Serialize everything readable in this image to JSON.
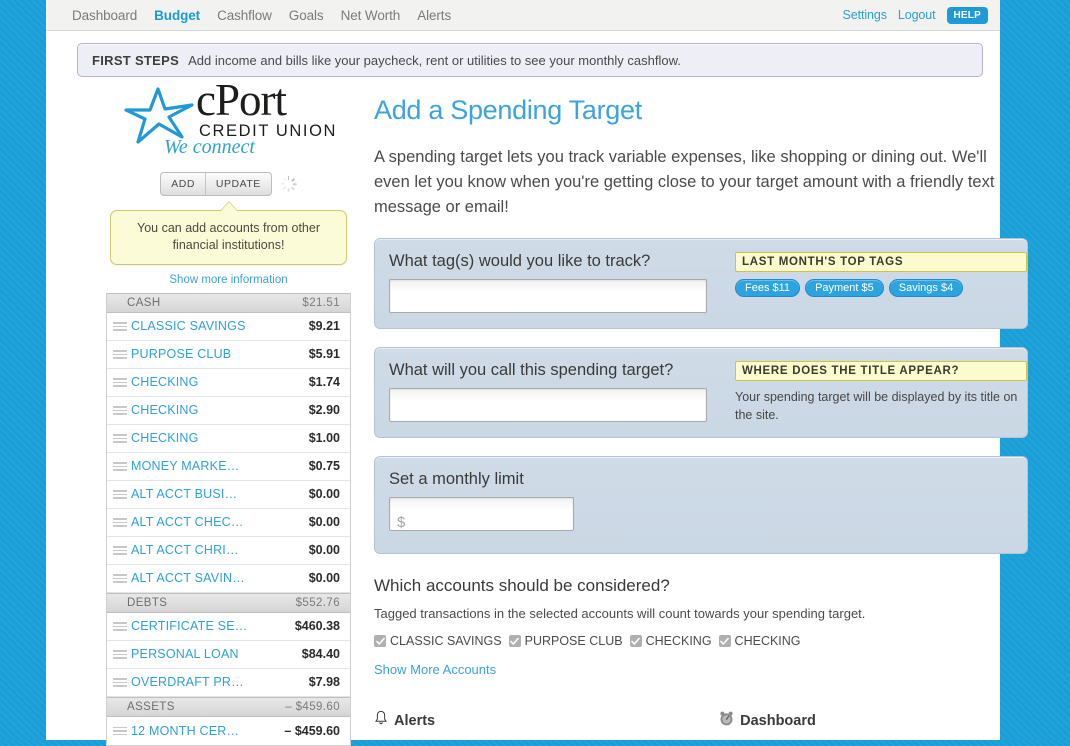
{
  "topnav": {
    "left_links": [
      {
        "label": "Dashboard",
        "active": false
      },
      {
        "label": "Budget",
        "active": true
      },
      {
        "label": "Cashflow",
        "active": false
      },
      {
        "label": "Goals",
        "active": false
      },
      {
        "label": "Net Worth",
        "active": false
      },
      {
        "label": "Alerts",
        "active": false
      }
    ],
    "settings_label": "Settings",
    "logout_label": "Logout",
    "help_label": "HELP"
  },
  "first_steps": {
    "label": "FIRST STEPS",
    "text": "Add income and bills like your paycheck, rent or utilities to see your monthly cashflow."
  },
  "logo": {
    "name": "cPort",
    "subtitle": "CREDIT UNION",
    "tagline": "We connect",
    "star_color": "#1f9ad6"
  },
  "sidebar": {
    "add_label": "ADD",
    "update_label": "UPDATE",
    "tooltip": "You can add accounts from other financial institutions!",
    "show_more_information": "Show more information",
    "groups": [
      {
        "name": "CASH",
        "total": "$21.51",
        "accounts": [
          {
            "name": "CLASSIC SAVINGS",
            "balance": "$9.21"
          },
          {
            "name": "PURPOSE CLUB",
            "balance": "$5.91"
          },
          {
            "name": "CHECKING",
            "balance": "$1.74"
          },
          {
            "name": "CHECKING",
            "balance": "$2.90"
          },
          {
            "name": "CHECKING",
            "balance": "$1.00"
          },
          {
            "name": "MONEY MARKE…",
            "balance": "$0.75"
          },
          {
            "name": "ALT ACCT BUSI…",
            "balance": "$0.00"
          },
          {
            "name": "ALT ACCT CHEC…",
            "balance": "$0.00"
          },
          {
            "name": "ALT ACCT CHRI…",
            "balance": "$0.00"
          },
          {
            "name": "ALT ACCT SAVIN…",
            "balance": "$0.00"
          }
        ]
      },
      {
        "name": "DEBTS",
        "total": "$552.76",
        "accounts": [
          {
            "name": "CERTIFICATE SE…",
            "balance": "$460.38"
          },
          {
            "name": "PERSONAL LOAN",
            "balance": "$84.40"
          },
          {
            "name": "OVERDRAFT PR…",
            "balance": "$7.98"
          }
        ]
      },
      {
        "name": "ASSETS",
        "total": "– $459.60",
        "accounts": [
          {
            "name": "12 MONTH CER…",
            "balance": "– $459.60"
          }
        ]
      }
    ]
  },
  "main": {
    "title": "Add a Spending Target",
    "intro": "A spending target lets you track variable expenses, like shopping or dining out. We'll even let you know when you're getting close to your target amount with a friendly text message or email!",
    "tag_panel": {
      "question": "What tag(s) would you like to track?",
      "input_value": "",
      "input_placeholder": "",
      "note_title": "LAST MONTH'S TOP TAGS",
      "tags": [
        "Fees $11",
        "Payment $5",
        "Savings $4"
      ]
    },
    "title_panel": {
      "question": "What will you call this spending target?",
      "input_value": "",
      "input_placeholder": "",
      "note_title": "WHERE DOES THE TITLE APPEAR?",
      "note_body": "Your spending target will be displayed by its title on the site."
    },
    "limit_panel": {
      "question": "Set a monthly limit",
      "currency_symbol": "$",
      "input_value": "",
      "input_placeholder": ""
    },
    "accounts": {
      "heading": "Which accounts should be considered?",
      "subtext": "Tagged transactions in the selected accounts will count towards your spending target.",
      "items": [
        {
          "label": "CLASSIC SAVINGS",
          "checked": true
        },
        {
          "label": "PURPOSE CLUB",
          "checked": true
        },
        {
          "label": "CHECKING",
          "checked": true
        },
        {
          "label": "CHECKING",
          "checked": true
        }
      ],
      "show_more_label": "Show More Accounts"
    }
  },
  "footer": {
    "alerts_label": "Alerts",
    "dashboard_label": "Dashboard"
  },
  "colors": {
    "page_background": "#1a9ed8",
    "accent_blue": "#3ba3dd",
    "panel_blue": "#cfdbe7",
    "note_yellow": "#fbfbcd"
  }
}
